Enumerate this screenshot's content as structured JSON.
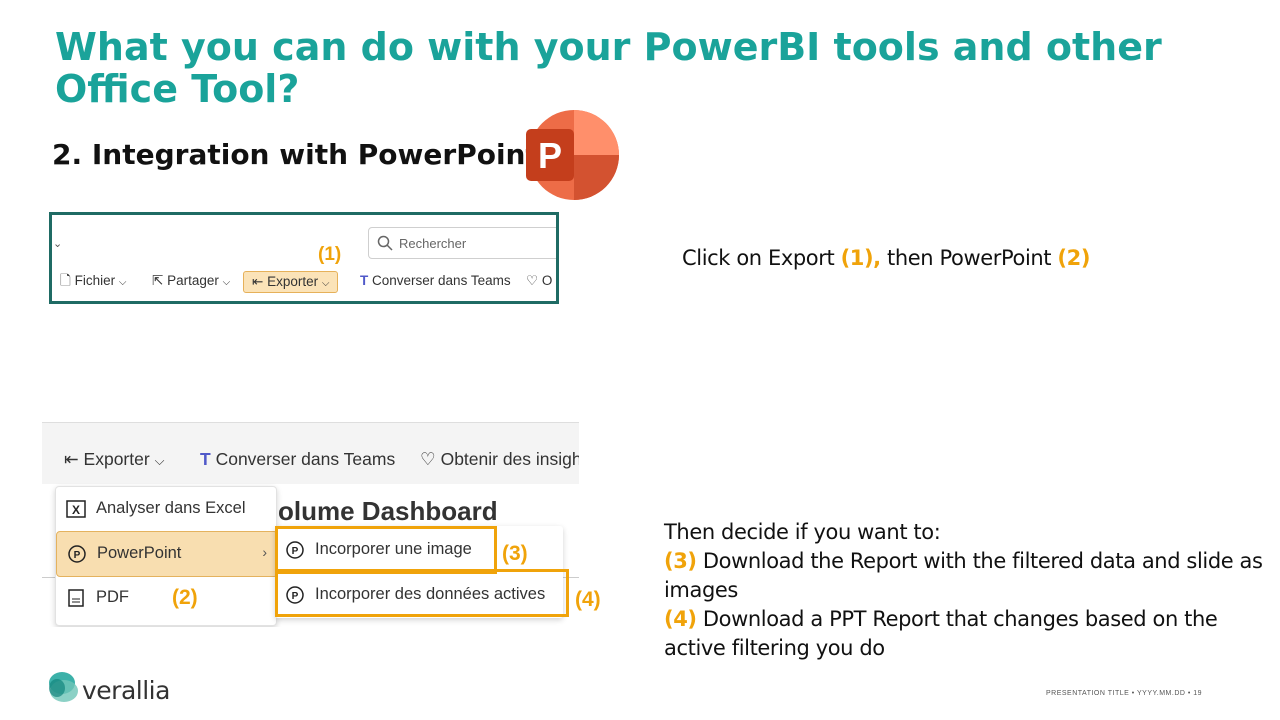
{
  "slide": {
    "title": "What you can do with your PowerBI tools and other Office Tool?",
    "subtitle": "2. Integration with PowerPoint",
    "footer": "PRESENTATION TITLE  •  YYYY.MM.DD  •  19"
  },
  "screenshot1": {
    "search_placeholder": "Rechercher",
    "marker1": "(1)",
    "toolbar": [
      "Fichier",
      "Partager",
      "Exporter",
      "Converser dans Teams",
      "O"
    ]
  },
  "instruction1": {
    "text_a": "Click on Export ",
    "num1": "(1),",
    "text_b": " then PowerPoint ",
    "num2": "(2)"
  },
  "screenshot2": {
    "topbar": {
      "exporter": "Exporter",
      "teams": "Converser dans Teams",
      "insights": "Obtenir des insigh"
    },
    "dashboard_title": "olume Dashboard",
    "menu": [
      "Analyser dans Excel",
      "PowerPoint",
      "PDF"
    ],
    "submenu": [
      "Incorporer une image",
      "Incorporer des données actives"
    ],
    "markers": [
      "(2)",
      "(3)",
      "(4)"
    ]
  },
  "instruction2": {
    "line1": "Then decide if you want to:",
    "num3": "(3)",
    "line2": " Download the Report with the filtered data and slide as images",
    "num4": "(4)",
    "line3": " Download a PPT Report that changes based on the active filtering you do"
  },
  "brand": {
    "name": "verallia"
  },
  "colors": {
    "title": "#1aa39a",
    "accent": "#f0a30a",
    "frame": "#1f6b64",
    "ppt": "#c43e1c"
  }
}
